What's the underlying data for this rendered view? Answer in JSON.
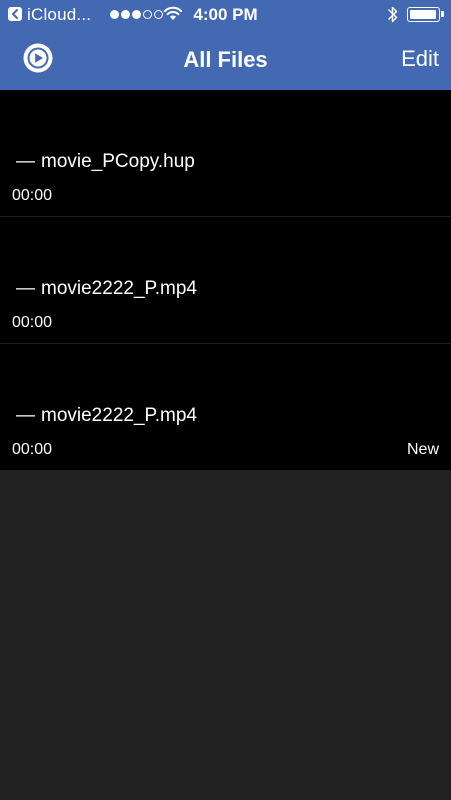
{
  "status_bar": {
    "back_app": "iCloud...",
    "time": "4:00 PM",
    "signal_bars_filled": 3,
    "signal_bars_total": 5,
    "battery_level": 0.9
  },
  "nav": {
    "title": "All Files",
    "edit_label": "Edit",
    "logo_icon": "play-circle-icon"
  },
  "files": [
    {
      "name": "movie_PCopy.hup",
      "duration": "00:00",
      "badge": ""
    },
    {
      "name": "movie2222_P.mp4",
      "duration": "00:00",
      "badge": ""
    },
    {
      "name": "movie2222_P.mp4",
      "duration": "00:00",
      "badge": "New"
    }
  ],
  "colors": {
    "nav_bg": "#4469b3",
    "list_bg": "#000000",
    "empty_bg": "#212121",
    "text": "#ffffff"
  }
}
